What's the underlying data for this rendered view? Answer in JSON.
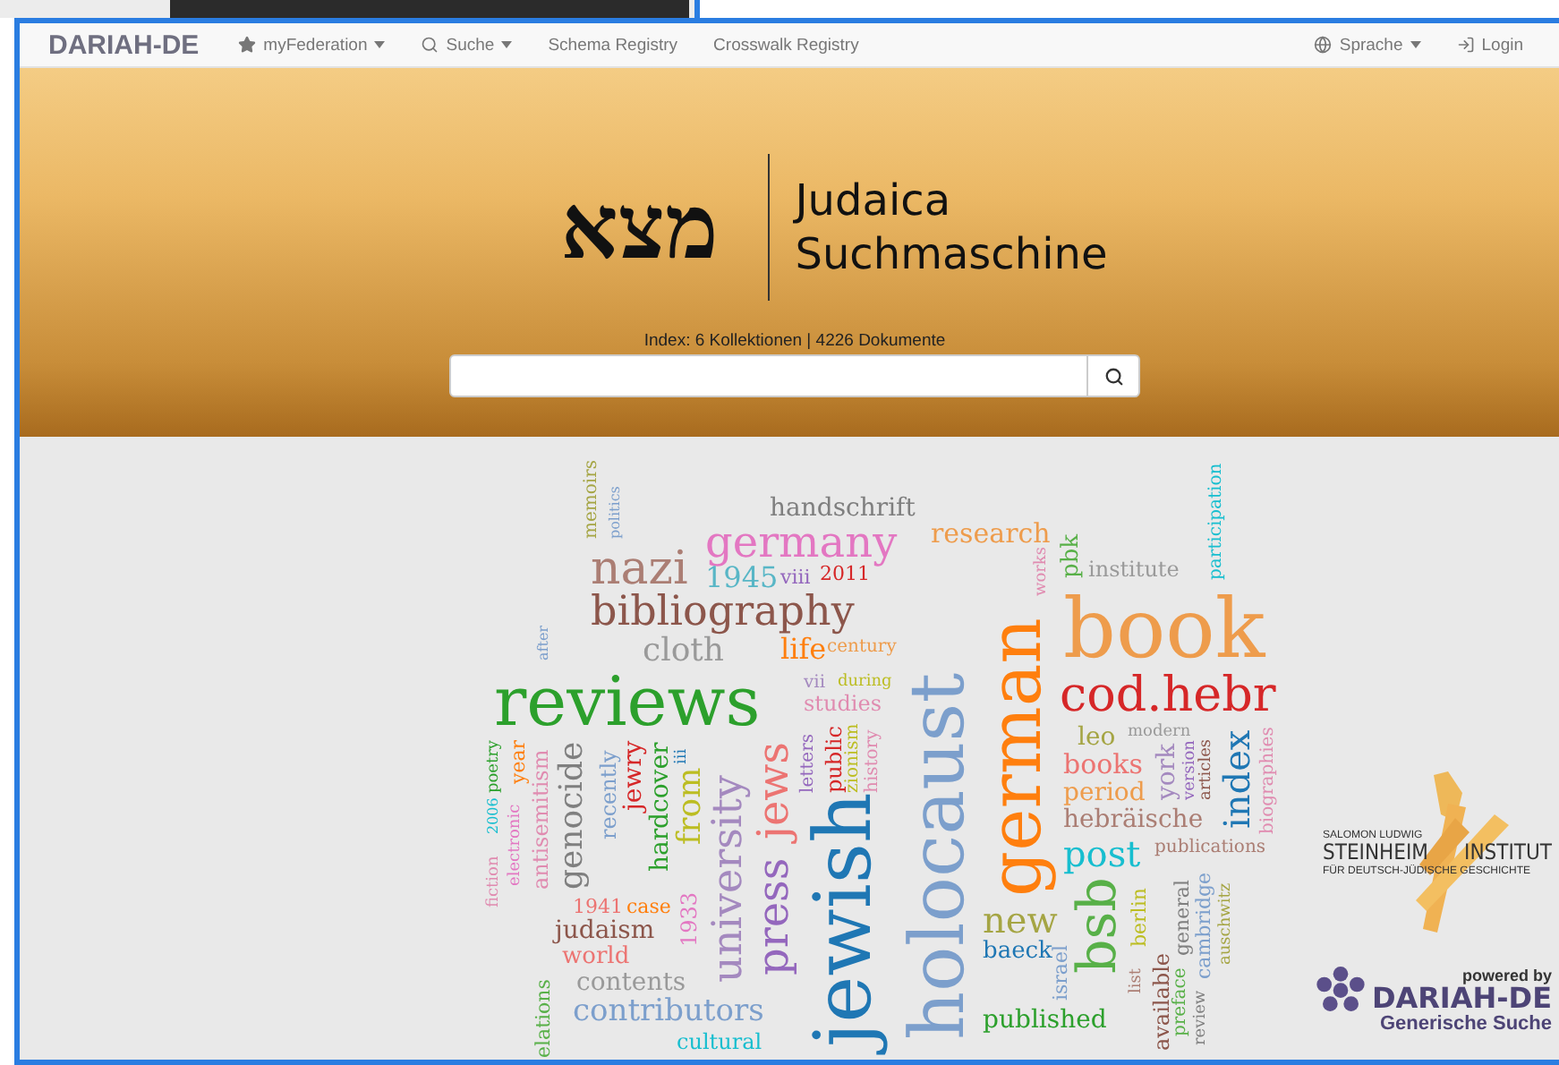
{
  "navbar": {
    "brand": "DARIAH-DE",
    "items": [
      {
        "label": "myFederation",
        "kind": "dropdown"
      },
      {
        "label": "Suche",
        "kind": "dropdown"
      },
      {
        "label": "Schema Registry",
        "kind": "link"
      },
      {
        "label": "Crosswalk Registry",
        "kind": "link"
      }
    ],
    "right_items": [
      {
        "label": "Sprache",
        "kind": "dropdown"
      },
      {
        "label": "Login",
        "kind": "link"
      }
    ]
  },
  "header": {
    "logo_hebrew": "מצא",
    "title_lines": [
      "Judaica",
      "Suchmaschine"
    ],
    "index_info": "Index: 6 Kollektionen | 4226 Dokumente"
  },
  "word_cloud": [
    {
      "text": "handschrift",
      "color": "#7f7f7f",
      "kind": "horizontal"
    },
    {
      "text": "germany",
      "color": "#e377c2",
      "kind": "horizontal"
    },
    {
      "text": "research",
      "color": "#ee9c4c",
      "kind": "horizontal"
    },
    {
      "text": "nazi",
      "color": "#ab7e74",
      "kind": "horizontal"
    },
    {
      "text": "1945",
      "color": "#58b6c6",
      "kind": "horizontal"
    },
    {
      "text": "viii",
      "color": "#9467bd",
      "kind": "horizontal"
    },
    {
      "text": "2011",
      "color": "#d62728",
      "kind": "horizontal"
    },
    {
      "text": "institute",
      "color": "#9a9a9a",
      "kind": "horizontal"
    },
    {
      "text": "bibliography",
      "color": "#8c564b",
      "kind": "horizontal"
    },
    {
      "text": "cloth",
      "color": "#9a9a9a",
      "kind": "horizontal"
    },
    {
      "text": "life",
      "color": "#ff7f0e",
      "kind": "horizontal"
    },
    {
      "text": "century",
      "color": "#ee9c4c",
      "kind": "horizontal"
    },
    {
      "text": "book",
      "color": "#ee9c4c",
      "kind": "horizontal"
    },
    {
      "text": "modern",
      "color": "#9a9a9a",
      "kind": "horizontal"
    },
    {
      "text": "reviews",
      "color": "#2ca02c",
      "kind": "horizontal"
    },
    {
      "text": "cod.hebr",
      "color": "#d62728",
      "kind": "horizontal"
    },
    {
      "text": "leo",
      "color": "#a5a544",
      "kind": "horizontal"
    },
    {
      "text": "books",
      "color": "#ec7472",
      "kind": "horizontal"
    },
    {
      "text": "period",
      "color": "#ee9c4c",
      "kind": "horizontal"
    },
    {
      "text": "hebräische",
      "color": "#ab7e74",
      "kind": "horizontal"
    },
    {
      "text": "post",
      "color": "#17becf",
      "kind": "horizontal"
    },
    {
      "text": "publications",
      "color": "#ab7e74",
      "kind": "horizontal"
    },
    {
      "text": "new",
      "color": "#a5a544",
      "kind": "horizontal"
    },
    {
      "text": "baeck",
      "color": "#1f77b4",
      "kind": "horizontal"
    },
    {
      "text": "published",
      "color": "#2ca02c",
      "kind": "horizontal"
    },
    {
      "text": "vii",
      "color": "#a489bf",
      "kind": "horizontal"
    },
    {
      "text": "during",
      "color": "#bcbd22",
      "kind": "horizontal"
    },
    {
      "text": "studies",
      "color": "#e08bb0",
      "kind": "horizontal"
    },
    {
      "text": "1941",
      "color": "#ec7472",
      "kind": "horizontal"
    },
    {
      "text": "case",
      "color": "#ff7f0e",
      "kind": "horizontal"
    },
    {
      "text": "judaism",
      "color": "#8c564b",
      "kind": "horizontal"
    },
    {
      "text": "world",
      "color": "#ec7472",
      "kind": "horizontal"
    },
    {
      "text": "contents",
      "color": "#9a9a9a",
      "kind": "horizontal"
    },
    {
      "text": "contributors",
      "color": "#7c9fcc",
      "kind": "horizontal"
    },
    {
      "text": "cultural",
      "color": "#17becf",
      "kind": "horizontal"
    },
    {
      "text": "memoirs",
      "color": "#a5a544",
      "kind": "vertical"
    },
    {
      "text": "politics",
      "color": "#7c9fcc",
      "kind": "vertical"
    },
    {
      "text": "participation",
      "color": "#17becf",
      "kind": "vertical"
    },
    {
      "text": "pbk",
      "color": "#58b048",
      "kind": "vertical"
    },
    {
      "text": "works",
      "color": "#e08bb0",
      "kind": "vertical"
    },
    {
      "text": "after",
      "color": "#7c9fcc",
      "kind": "vertical"
    },
    {
      "text": "jewish",
      "color": "#1f77b4",
      "kind": "vertical"
    },
    {
      "text": "holocaust",
      "color": "#7c9fcc",
      "kind": "vertical"
    },
    {
      "text": "german",
      "color": "#ff7f0e",
      "kind": "vertical"
    },
    {
      "text": "bsb",
      "color": "#58b048",
      "kind": "vertical"
    },
    {
      "text": "genocide",
      "color": "#7f7f7f",
      "kind": "vertical"
    },
    {
      "text": "antisemitism",
      "color": "#e08bb0",
      "kind": "vertical"
    },
    {
      "text": "recently",
      "color": "#7c9fcc",
      "kind": "vertical"
    },
    {
      "text": "jewry",
      "color": "#d62728",
      "kind": "vertical"
    },
    {
      "text": "hardcover",
      "color": "#2ca02c",
      "kind": "vertical"
    },
    {
      "text": "from",
      "color": "#bcbd22",
      "kind": "vertical"
    },
    {
      "text": "iii",
      "color": "#1f77b4",
      "kind": "vertical"
    },
    {
      "text": "1933",
      "color": "#e377c2",
      "kind": "vertical"
    },
    {
      "text": "university",
      "color": "#a489bf",
      "kind": "vertical"
    },
    {
      "text": "electronic",
      "color": "#e377c2",
      "kind": "vertical"
    },
    {
      "text": "year",
      "color": "#ff7f0e",
      "kind": "vertical"
    },
    {
      "text": "jews",
      "color": "#ec7472",
      "kind": "vertical"
    },
    {
      "text": "press",
      "color": "#9467bd",
      "kind": "vertical"
    },
    {
      "text": "public",
      "color": "#d62728",
      "kind": "vertical"
    },
    {
      "text": "zionism",
      "color": "#bcbd22",
      "kind": "vertical"
    },
    {
      "text": "letters",
      "color": "#9467bd",
      "kind": "vertical"
    },
    {
      "text": "history",
      "color": "#e08bb0",
      "kind": "vertical"
    },
    {
      "text": "poetry",
      "color": "#2ca02c",
      "kind": "vertical"
    },
    {
      "text": "2006",
      "color": "#17becf",
      "kind": "vertical"
    },
    {
      "text": "fiction",
      "color": "#e08bb0",
      "kind": "vertical"
    },
    {
      "text": "berlin",
      "color": "#bcbd22",
      "kind": "vertical"
    },
    {
      "text": "list",
      "color": "#ab7e74",
      "kind": "vertical"
    },
    {
      "text": "israel",
      "color": "#7c9fcc",
      "kind": "vertical"
    },
    {
      "text": "available",
      "color": "#8c564b",
      "kind": "vertical"
    },
    {
      "text": "york",
      "color": "#a489bf",
      "kind": "vertical"
    },
    {
      "text": "version",
      "color": "#9467bd",
      "kind": "vertical"
    },
    {
      "text": "articles",
      "color": "#8c564b",
      "kind": "vertical"
    },
    {
      "text": "index",
      "color": "#1f77b4",
      "kind": "vertical"
    },
    {
      "text": "biographies",
      "color": "#e08bb0",
      "kind": "vertical"
    },
    {
      "text": "general",
      "color": "#7f7f7f",
      "kind": "vertical"
    },
    {
      "text": "preface",
      "color": "#58b048",
      "kind": "vertical"
    },
    {
      "text": "cambridge",
      "color": "#7c9fcc",
      "kind": "vertical"
    },
    {
      "text": "review",
      "color": "#7f7f7f",
      "kind": "vertical"
    },
    {
      "text": "auschwitz",
      "color": "#a5a544",
      "kind": "vertical"
    },
    {
      "text": "elations",
      "color": "#58b048",
      "kind": "vertical"
    }
  ],
  "partners": {
    "steinheim": {
      "top_line": "SALOMON LUDWIG",
      "name_left": "STEINHEIM",
      "name_right": "INSTITUT",
      "subtitle": "FÜR DEUTSCH-JÜDISCHE GESCHICHTE"
    },
    "dariah": {
      "powered_by": "powered by",
      "name": "DARIAH-DE",
      "subtitle": "Generische Suche"
    }
  }
}
